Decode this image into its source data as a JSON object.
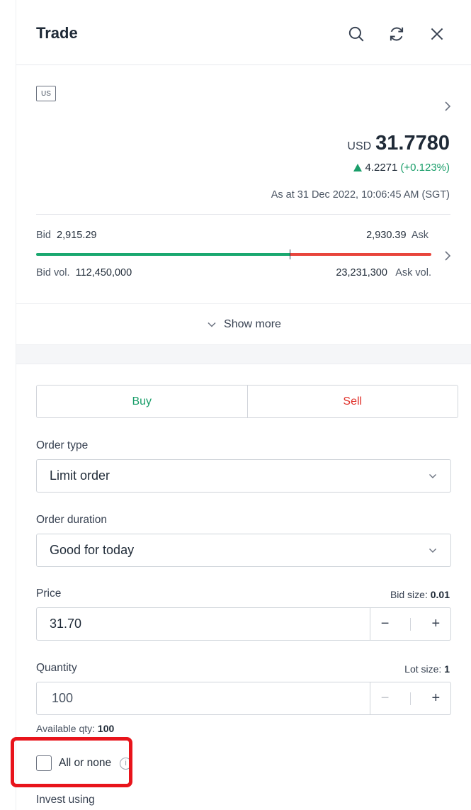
{
  "header": {
    "title": "Trade"
  },
  "instrument": {
    "market_tag": "US",
    "currency": "USD",
    "price": "31.7780",
    "change_value": "4.2271",
    "change_percent": "(+0.123%)",
    "timestamp": "As at 31 Dec 2022, 10:06:45 AM (SGT)"
  },
  "depth": {
    "bid_label": "Bid",
    "bid_value": "2,915.29",
    "ask_value": "2,930.39",
    "ask_label": "Ask",
    "bid_vol_label": "Bid vol.",
    "bid_vol_value": "112,450,000",
    "ask_vol_value": "23,231,300",
    "ask_vol_label": "Ask vol.",
    "bid_share": 0.642,
    "colors": {
      "bid": "#1aa86f",
      "ask": "#e8453c"
    }
  },
  "show_more": {
    "label": "Show more"
  },
  "side_toggle": {
    "buy": "Buy",
    "sell": "Sell"
  },
  "order_type": {
    "label": "Order type",
    "value": "Limit order"
  },
  "order_duration": {
    "label": "Order duration",
    "value": "Good for today"
  },
  "price_field": {
    "label": "Price",
    "size_label": "Bid size:",
    "size_value": "0.01",
    "value": "31.70",
    "minus": "−",
    "plus": "+"
  },
  "quantity_field": {
    "label": "Quantity",
    "size_label": "Lot size:",
    "size_value": "1",
    "value": "100",
    "minus": "−",
    "plus": "+"
  },
  "available": {
    "label": "Available qty:",
    "value": "100"
  },
  "all_or_none": {
    "label": "All or none",
    "checked": false,
    "info": "i"
  },
  "invest_using": {
    "label": "Invest using"
  }
}
